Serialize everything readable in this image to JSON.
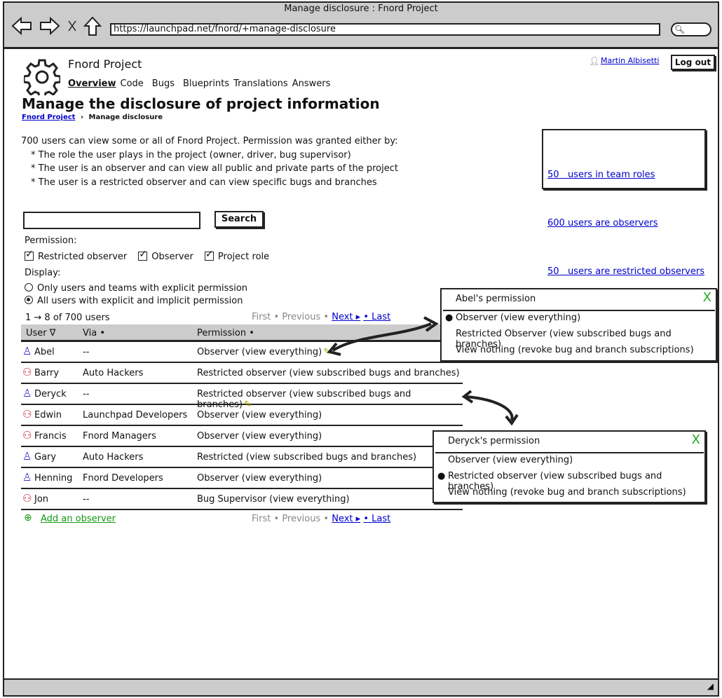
{
  "browser": {
    "title": "Manage disclosure : Fnord Project",
    "url": "https://launchpad.net/fnord/+manage-disclosure"
  },
  "header": {
    "project": "Fnord Project",
    "user": "Martin Albisetti",
    "logout": "Log out",
    "tabs": [
      "Overview",
      "Code",
      "Bugs",
      "Blueprints",
      "Translations",
      "Answers"
    ]
  },
  "page": {
    "heading": "Manage the disclosure of project information",
    "breadcrumb": [
      "Fnord Project",
      "Manage disclosure"
    ],
    "intro": "700 users can view some or all of Fnord Project. Permission was granted either by:",
    "bullets": [
      "* The role the user plays in the project (owner, driver, bug supervisor)",
      "* The user is an observer and can view all public and private parts of the project",
      "* The user is a restricted observer and can view specific bugs and branches"
    ]
  },
  "summary": [
    "50   users in team roles",
    "600 users are observers",
    "50   users are restricted observers"
  ],
  "search": {
    "value": "",
    "button": "Search"
  },
  "filters": {
    "permission_label": "Permission:",
    "checks": [
      "Restricted observer",
      "Observer",
      "Project role"
    ],
    "display_label": "Display:",
    "radios": [
      "Only users and teams with explicit permission",
      "All users with explicit and implicit permission"
    ],
    "selected_radio": 1
  },
  "batch": {
    "count": "1 → 8 of 700 users",
    "first": "First",
    "previous": "Previous",
    "next": "Next",
    "last": "Last",
    "sep": "•"
  },
  "table": {
    "headers": [
      "User ∇",
      "Via •",
      "Permission •"
    ],
    "rows": [
      {
        "user": "Abel",
        "type": "person",
        "via": "--",
        "permission": "Observer (view everything)",
        "editable": true
      },
      {
        "user": "Barry",
        "type": "team",
        "via": "Auto Hackers",
        "permission": "Restricted observer (view subscribed bugs and branches)"
      },
      {
        "user": "Deryck",
        "type": "person",
        "via": "--",
        "permission": "Restricted observer (view subscribed bugs and branches)",
        "editable": true
      },
      {
        "user": "Edwin",
        "type": "team",
        "via": "Launchpad Developers",
        "permission": "Observer (view everything)"
      },
      {
        "user": "Francis",
        "type": "team",
        "via": "Fnord Managers",
        "permission": "Observer (view everything)"
      },
      {
        "user": "Gary",
        "type": "person",
        "via": "Auto Hackers",
        "permission": "Restricted (view subscribed bugs and branches)"
      },
      {
        "user": "Henning",
        "type": "person",
        "via": "Fnord Developers",
        "permission": "Observer (view everything)"
      },
      {
        "user": "Jon",
        "type": "team",
        "via": "--",
        "permission": "Bug Supervisor (view everything)"
      }
    ]
  },
  "add_observer": "Add an observer",
  "popups": [
    {
      "title": "Abel's permission",
      "close": "X",
      "options": [
        "Observer (view everything)",
        "Restricted Observer (view subscribed bugs and branches)",
        "View nothing (revoke bug and branch subscriptions)"
      ],
      "selected": 0
    },
    {
      "title": "Deryck's permission",
      "close": "X",
      "options": [
        "Observer (view everything)",
        "Restricted observer (view subscribed bugs and branches)",
        "View nothing (revoke bug and branch subscriptions)"
      ],
      "selected": 1
    }
  ],
  "colors": {
    "person": "#3333cc",
    "team": "#cc2233",
    "edit": "#aaaa00",
    "close": "#22aa22",
    "add": "#119911"
  }
}
